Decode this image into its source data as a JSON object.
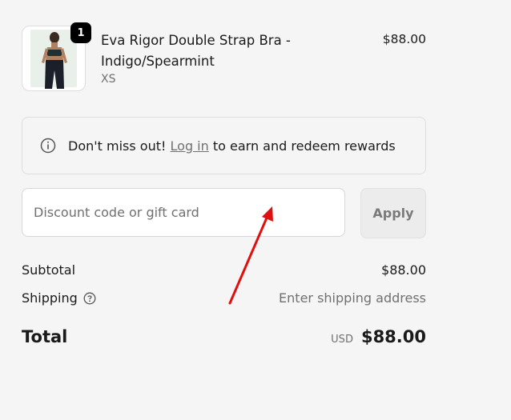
{
  "product": {
    "name": "Eva Rigor Double Strap Bra - Indigo/Spearmint",
    "variant": "XS",
    "price": "$88.00",
    "quantity": "1",
    "image_alt_colors": {
      "top": "#1f2f33",
      "skin": "#b08060",
      "bottom": "#1a1f2a"
    }
  },
  "rewards_banner": {
    "icon": "info-icon",
    "prefix": "Don't miss out!",
    "link_label": "Log in",
    "suffix": "to earn and redeem rewards"
  },
  "discount": {
    "placeholder": "Discount code or gift card",
    "value": "",
    "apply_label": "Apply"
  },
  "summary": {
    "subtotal_label": "Subtotal",
    "subtotal_value": "$88.00",
    "shipping_label": "Shipping",
    "shipping_help_icon": "question-circle-icon",
    "shipping_value": "Enter shipping address",
    "total_label": "Total",
    "currency": "USD",
    "total_value": "$88.00"
  },
  "colors": {
    "background": "#f5f5f5",
    "badge": "#000000",
    "muted_text": "#707070",
    "annotation_arrow": "#e01010"
  }
}
